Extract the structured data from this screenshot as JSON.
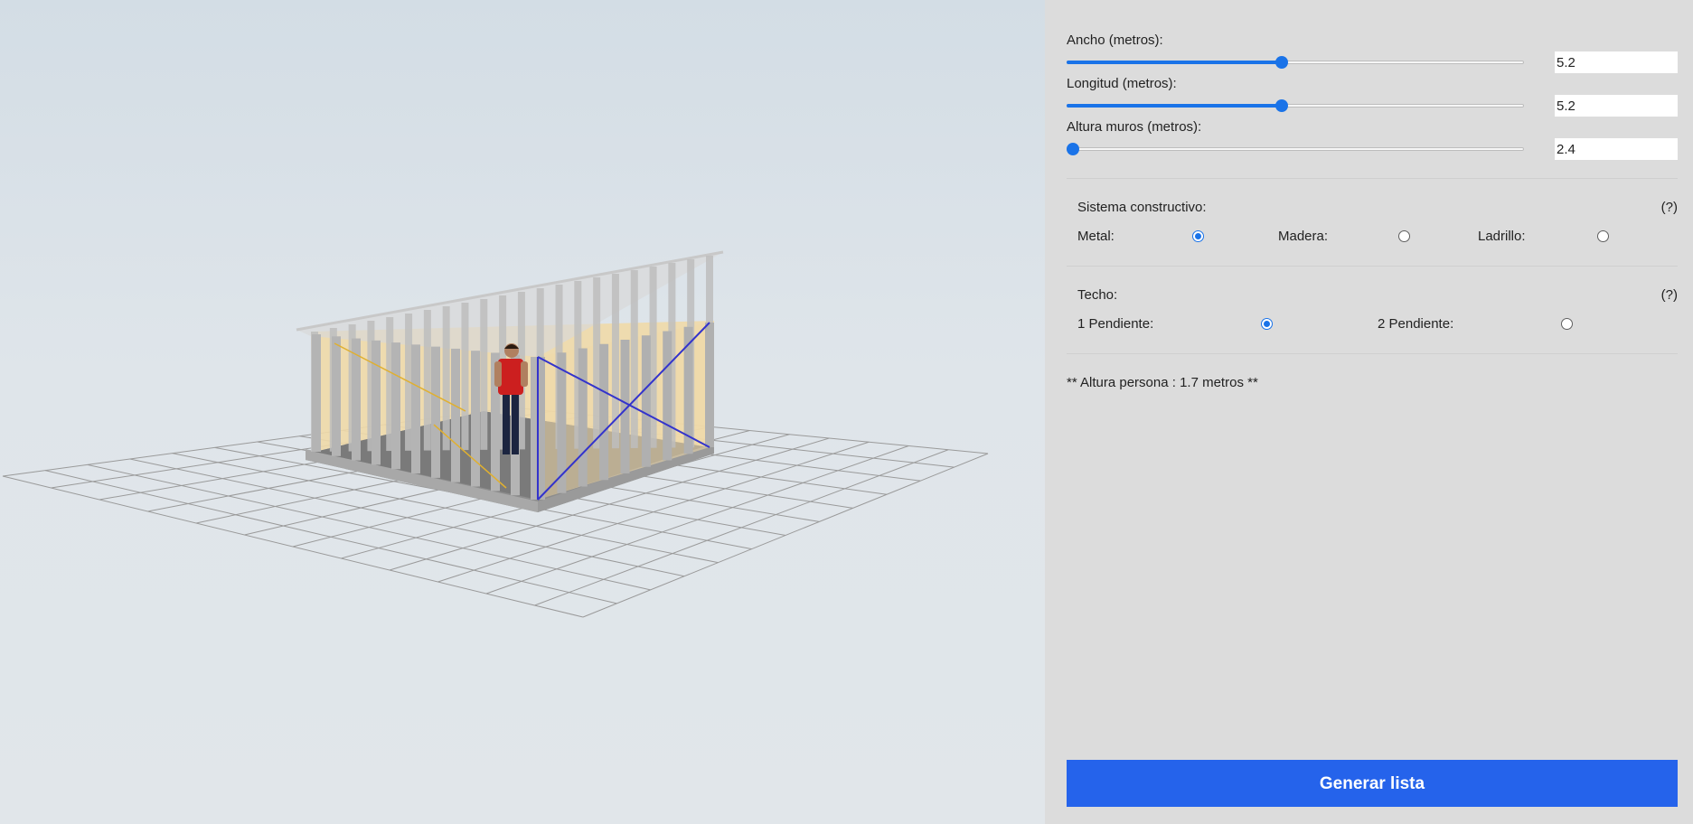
{
  "viewer": {
    "grid_color": "#9a9a9a",
    "frame_color": "#bdbdbd",
    "insulation_color": "#f0d9a8",
    "floor_color": "#8d8d8d",
    "bracing_color": "#3333cc",
    "person_shirt_color": "#cc1f1f"
  },
  "controls": {
    "ancho": {
      "label": "Ancho (metros):",
      "value": "5.2",
      "fraction": 0.47
    },
    "longitud": {
      "label": "Longitud (metros):",
      "value": "5.2",
      "fraction": 0.47
    },
    "altura": {
      "label": "Altura muros (metros):",
      "value": "2.4",
      "fraction": 0.0
    }
  },
  "sistema": {
    "title": "Sistema constructivo:",
    "help": "(?)",
    "options": [
      {
        "label": "Metal:",
        "checked": true
      },
      {
        "label": "Madera:",
        "checked": false
      },
      {
        "label": "Ladrillo:",
        "checked": false
      }
    ]
  },
  "techo": {
    "title": "Techo:",
    "help": "(?)",
    "options": [
      {
        "label": "1 Pendiente:",
        "checked": true
      },
      {
        "label": "2 Pendiente:",
        "checked": false
      }
    ]
  },
  "note": "** Altura persona : 1.7 metros **",
  "generate_label": "Generar lista",
  "accent_color": "#1a73e8",
  "button_color": "#2563eb"
}
